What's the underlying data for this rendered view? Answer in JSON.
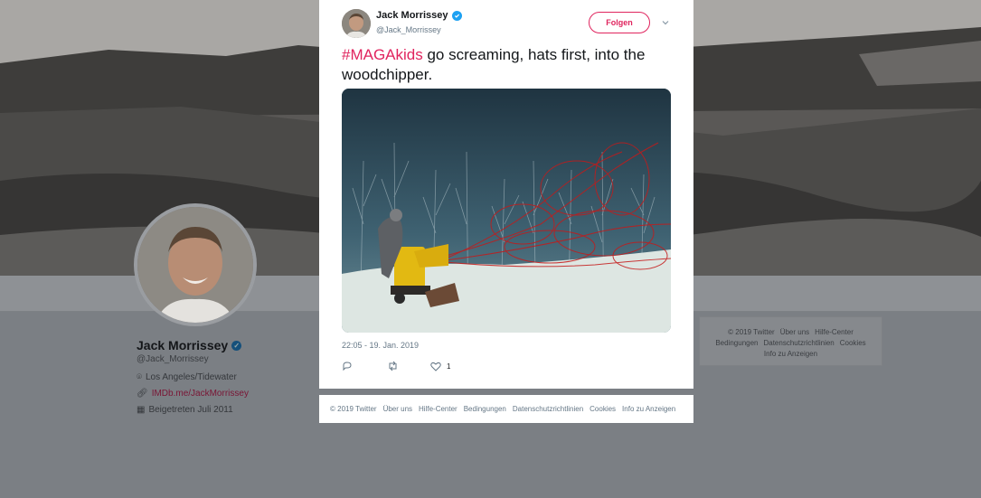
{
  "profile": {
    "name": "Jack Morrissey",
    "handle": "@Jack_Morrissey",
    "location": "Los Angeles/Tidewater",
    "website": "IMDb.me/JackMorrissey",
    "joined": "Beigetreten Juli 2011"
  },
  "side_footer": {
    "line1": [
      "© 2019 Twitter",
      "Über uns",
      "Hilfe-Center"
    ],
    "line2": [
      "Bedingungen",
      "Datenschutzrichtlinien",
      "Cookies"
    ],
    "line3": [
      "Info zu Anzeigen"
    ]
  },
  "tweet": {
    "author_name": "Jack Morrissey",
    "author_handle": "@Jack_Morrissey",
    "follow_label": "Folgen",
    "hashtag": "#MAGAkids",
    "text": " go screaming, hats first, into the woodchipper.",
    "timestamp": "22:05 - 19. Jan. 2019",
    "like_count": "1"
  },
  "modal_footer": {
    "links": [
      "© 2019 Twitter",
      "Über uns",
      "Hilfe-Center",
      "Bedingungen",
      "Datenschutzrichtlinien",
      "Cookies",
      "Info zu Anzeigen"
    ]
  },
  "colors": {
    "accent": "#e0245e",
    "verified": "#1da1f2",
    "secondary_text": "#657786"
  },
  "icons": [
    "verified-badge-icon",
    "chevron-down-icon",
    "reply-icon",
    "retweet-icon",
    "heart-icon",
    "location-icon",
    "link-icon",
    "calendar-icon"
  ]
}
